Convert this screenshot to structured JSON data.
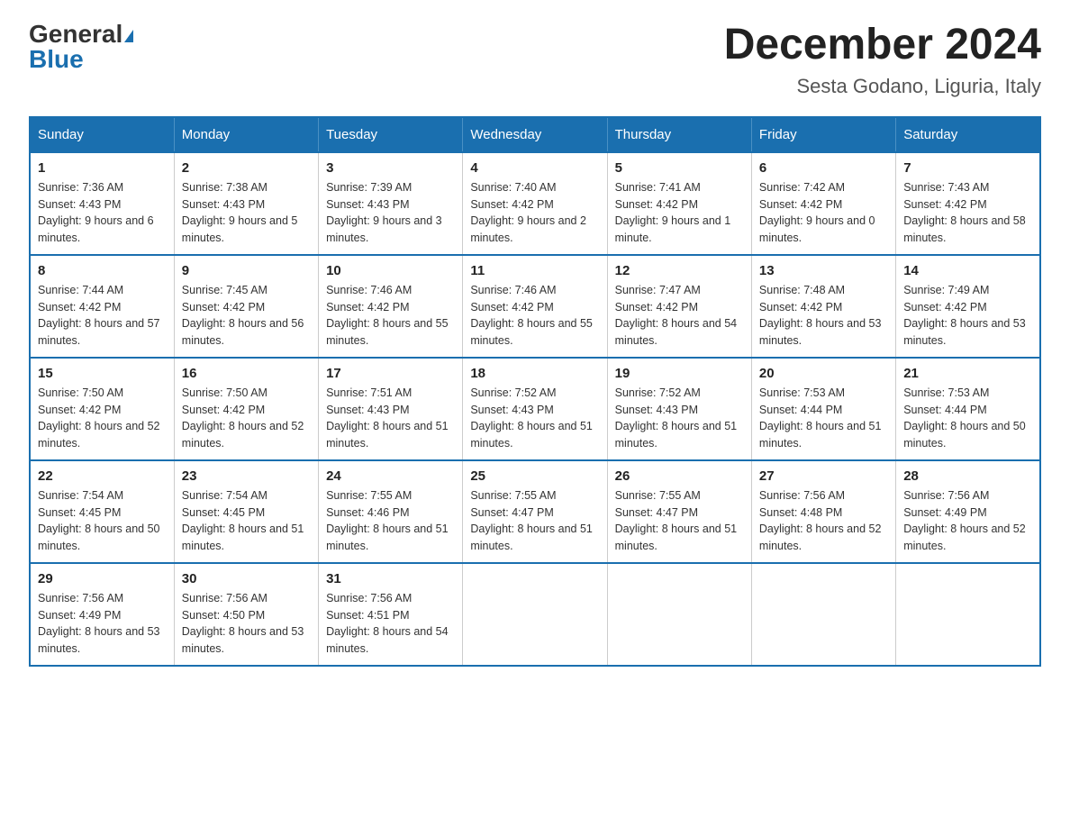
{
  "header": {
    "logo_general": "General",
    "logo_blue": "Blue",
    "month_year": "December 2024",
    "location": "Sesta Godano, Liguria, Italy"
  },
  "days_of_week": [
    "Sunday",
    "Monday",
    "Tuesday",
    "Wednesday",
    "Thursday",
    "Friday",
    "Saturday"
  ],
  "weeks": [
    [
      {
        "day": "1",
        "sunrise": "7:36 AM",
        "sunset": "4:43 PM",
        "daylight": "9 hours and 6 minutes."
      },
      {
        "day": "2",
        "sunrise": "7:38 AM",
        "sunset": "4:43 PM",
        "daylight": "9 hours and 5 minutes."
      },
      {
        "day": "3",
        "sunrise": "7:39 AM",
        "sunset": "4:43 PM",
        "daylight": "9 hours and 3 minutes."
      },
      {
        "day": "4",
        "sunrise": "7:40 AM",
        "sunset": "4:42 PM",
        "daylight": "9 hours and 2 minutes."
      },
      {
        "day": "5",
        "sunrise": "7:41 AM",
        "sunset": "4:42 PM",
        "daylight": "9 hours and 1 minute."
      },
      {
        "day": "6",
        "sunrise": "7:42 AM",
        "sunset": "4:42 PM",
        "daylight": "9 hours and 0 minutes."
      },
      {
        "day": "7",
        "sunrise": "7:43 AM",
        "sunset": "4:42 PM",
        "daylight": "8 hours and 58 minutes."
      }
    ],
    [
      {
        "day": "8",
        "sunrise": "7:44 AM",
        "sunset": "4:42 PM",
        "daylight": "8 hours and 57 minutes."
      },
      {
        "day": "9",
        "sunrise": "7:45 AM",
        "sunset": "4:42 PM",
        "daylight": "8 hours and 56 minutes."
      },
      {
        "day": "10",
        "sunrise": "7:46 AM",
        "sunset": "4:42 PM",
        "daylight": "8 hours and 55 minutes."
      },
      {
        "day": "11",
        "sunrise": "7:46 AM",
        "sunset": "4:42 PM",
        "daylight": "8 hours and 55 minutes."
      },
      {
        "day": "12",
        "sunrise": "7:47 AM",
        "sunset": "4:42 PM",
        "daylight": "8 hours and 54 minutes."
      },
      {
        "day": "13",
        "sunrise": "7:48 AM",
        "sunset": "4:42 PM",
        "daylight": "8 hours and 53 minutes."
      },
      {
        "day": "14",
        "sunrise": "7:49 AM",
        "sunset": "4:42 PM",
        "daylight": "8 hours and 53 minutes."
      }
    ],
    [
      {
        "day": "15",
        "sunrise": "7:50 AM",
        "sunset": "4:42 PM",
        "daylight": "8 hours and 52 minutes."
      },
      {
        "day": "16",
        "sunrise": "7:50 AM",
        "sunset": "4:42 PM",
        "daylight": "8 hours and 52 minutes."
      },
      {
        "day": "17",
        "sunrise": "7:51 AM",
        "sunset": "4:43 PM",
        "daylight": "8 hours and 51 minutes."
      },
      {
        "day": "18",
        "sunrise": "7:52 AM",
        "sunset": "4:43 PM",
        "daylight": "8 hours and 51 minutes."
      },
      {
        "day": "19",
        "sunrise": "7:52 AM",
        "sunset": "4:43 PM",
        "daylight": "8 hours and 51 minutes."
      },
      {
        "day": "20",
        "sunrise": "7:53 AM",
        "sunset": "4:44 PM",
        "daylight": "8 hours and 51 minutes."
      },
      {
        "day": "21",
        "sunrise": "7:53 AM",
        "sunset": "4:44 PM",
        "daylight": "8 hours and 50 minutes."
      }
    ],
    [
      {
        "day": "22",
        "sunrise": "7:54 AM",
        "sunset": "4:45 PM",
        "daylight": "8 hours and 50 minutes."
      },
      {
        "day": "23",
        "sunrise": "7:54 AM",
        "sunset": "4:45 PM",
        "daylight": "8 hours and 51 minutes."
      },
      {
        "day": "24",
        "sunrise": "7:55 AM",
        "sunset": "4:46 PM",
        "daylight": "8 hours and 51 minutes."
      },
      {
        "day": "25",
        "sunrise": "7:55 AM",
        "sunset": "4:47 PM",
        "daylight": "8 hours and 51 minutes."
      },
      {
        "day": "26",
        "sunrise": "7:55 AM",
        "sunset": "4:47 PM",
        "daylight": "8 hours and 51 minutes."
      },
      {
        "day": "27",
        "sunrise": "7:56 AM",
        "sunset": "4:48 PM",
        "daylight": "8 hours and 52 minutes."
      },
      {
        "day": "28",
        "sunrise": "7:56 AM",
        "sunset": "4:49 PM",
        "daylight": "8 hours and 52 minutes."
      }
    ],
    [
      {
        "day": "29",
        "sunrise": "7:56 AM",
        "sunset": "4:49 PM",
        "daylight": "8 hours and 53 minutes."
      },
      {
        "day": "30",
        "sunrise": "7:56 AM",
        "sunset": "4:50 PM",
        "daylight": "8 hours and 53 minutes."
      },
      {
        "day": "31",
        "sunrise": "7:56 AM",
        "sunset": "4:51 PM",
        "daylight": "8 hours and 54 minutes."
      },
      null,
      null,
      null,
      null
    ]
  ]
}
